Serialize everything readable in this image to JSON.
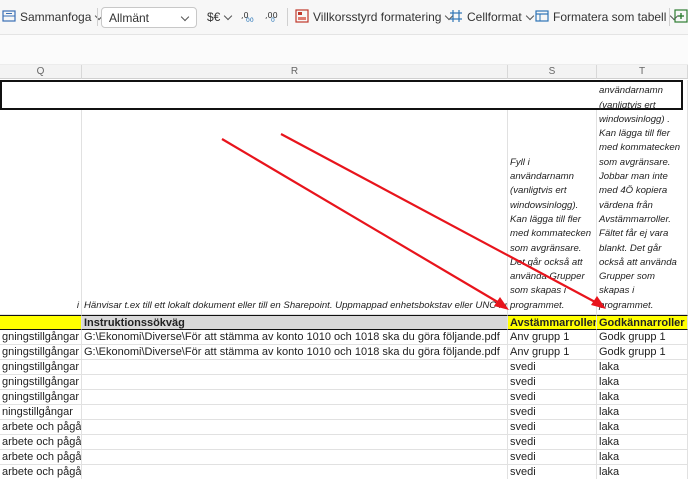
{
  "ribbon": {
    "merge_label": "Sammanfoga",
    "number_format": "Allmänt",
    "currency_symbol": "$€",
    "conditional_format_label": "Villkorsstyrd formatering",
    "cell_format_label": "Cellformat",
    "format_as_table_label": "Formatera som tabell"
  },
  "columns": [
    {
      "id": "Q",
      "label": "Q"
    },
    {
      "id": "R",
      "label": "R"
    },
    {
      "id": "S",
      "label": "S"
    },
    {
      "id": "T",
      "label": "T"
    }
  ],
  "notes": {
    "q": "i",
    "r": "Hänvisar t.ex till ett lokalt dokument eller till en Sharepoint. Uppmappad enhetsbokstav eller UNC fungerar.",
    "s": "Fyll i användarnamn (vanligtvis ert windowsinlogg). Kan lägga till fler med kommatecken som avgränsare. Det går också att använda Grupper som skapas i programmet.",
    "t": "Fyll i användarnamn (vanligtvis ert windowsinlogg) . Kan lägga till fler med kommatecken som avgränsare. Jobbar man inte med 4Ö kopiera värdena från Avstämmarroller. Fältet får ej vara blankt. Det går också att använda Grupper som skapas i programmet."
  },
  "header_row": {
    "q": "",
    "r": "Instruktionssökväg",
    "s": "Avstämmarroller",
    "t": "Godkännarroller"
  },
  "rows": [
    {
      "q": "gningstillgångar",
      "r": "G:\\Ekonomi\\Diverse\\För att stämma av konto 1010 och 1018 ska du göra följande.pdf",
      "s": "Anv grupp 1",
      "t": "Godk grupp 1"
    },
    {
      "q": "gningstillgångar",
      "r": "G:\\Ekonomi\\Diverse\\För att stämma av konto 1010 och 1018 ska du göra följande.pdf",
      "s": "Anv grupp 1",
      "t": "Godk grupp 1"
    },
    {
      "q": "gningstillgångar",
      "r": "",
      "s": "svedi",
      "t": "laka"
    },
    {
      "q": "gningstillgångar",
      "r": "",
      "s": "svedi",
      "t": "laka"
    },
    {
      "q": "gningstillgångar",
      "r": "",
      "s": "svedi",
      "t": "laka"
    },
    {
      "q": "ningstillgångar",
      "r": "",
      "s": "svedi",
      "t": "laka"
    },
    {
      "q": "arbete och pågående arbeten",
      "r": "",
      "s": "svedi",
      "t": "laka"
    },
    {
      "q": "arbete och pågående arbeten",
      "r": "",
      "s": "svedi",
      "t": "laka"
    },
    {
      "q": "arbete och pågående arbeten",
      "r": "",
      "s": "svedi",
      "t": "laka"
    },
    {
      "q": "arbete och pågående arbeten",
      "r": "",
      "s": "svedi",
      "t": "laka"
    }
  ],
  "annotation_color": "#e8141c"
}
